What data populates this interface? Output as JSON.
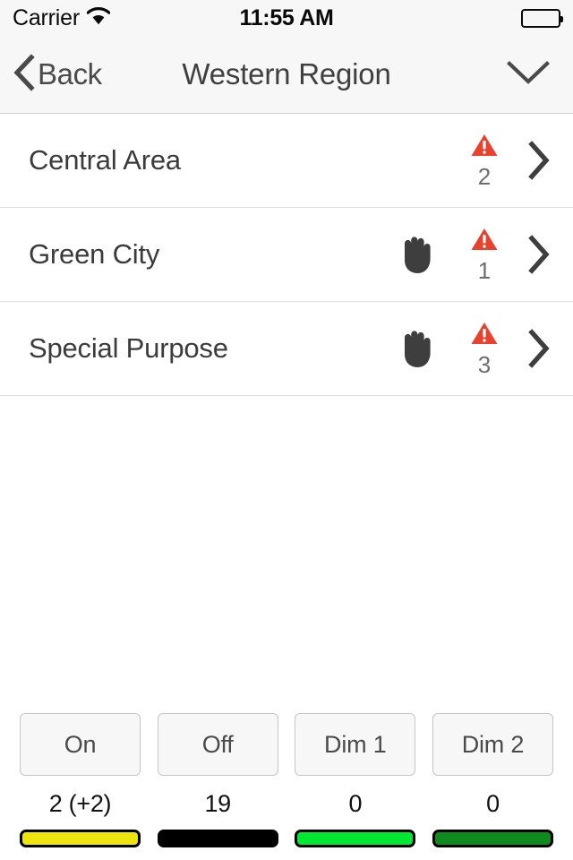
{
  "status_bar": {
    "carrier": "Carrier",
    "wifi_icon": "wifi-icon",
    "time": "11:55 AM",
    "battery_icon": "battery-full-icon"
  },
  "nav_bar": {
    "back_icon": "chevron-left-icon",
    "back_label": "Back",
    "title": "Western Region",
    "dropdown_icon": "chevron-down-icon"
  },
  "list": {
    "rows": [
      {
        "label": "Central Area",
        "hand_icon": "",
        "alert_icon": "warning-triangle-icon",
        "alert_count": "2",
        "chevron_icon": "chevron-right-icon"
      },
      {
        "label": "Green City",
        "hand_icon": "raised-hand-icon",
        "alert_icon": "warning-triangle-icon",
        "alert_count": "1",
        "chevron_icon": "chevron-right-icon"
      },
      {
        "label": "Special Purpose",
        "hand_icon": "raised-hand-icon",
        "alert_icon": "warning-triangle-icon",
        "alert_count": "3",
        "chevron_icon": "chevron-right-icon"
      }
    ]
  },
  "controls": [
    {
      "label": "On",
      "count": "2 (+2)",
      "color": "#ece40b"
    },
    {
      "label": "Off",
      "count": "19",
      "color": "#000000"
    },
    {
      "label": "Dim 1",
      "count": "0",
      "color": "#00e831"
    },
    {
      "label": "Dim 2",
      "count": "0",
      "color": "#0f8a1e"
    }
  ],
  "colors": {
    "alert_red": "#e8422e",
    "hand_grey": "#3e3e3e",
    "chrome_bg": "#f7f7f7",
    "separator": "#dedede",
    "text_primary": "#3b3b3b"
  }
}
